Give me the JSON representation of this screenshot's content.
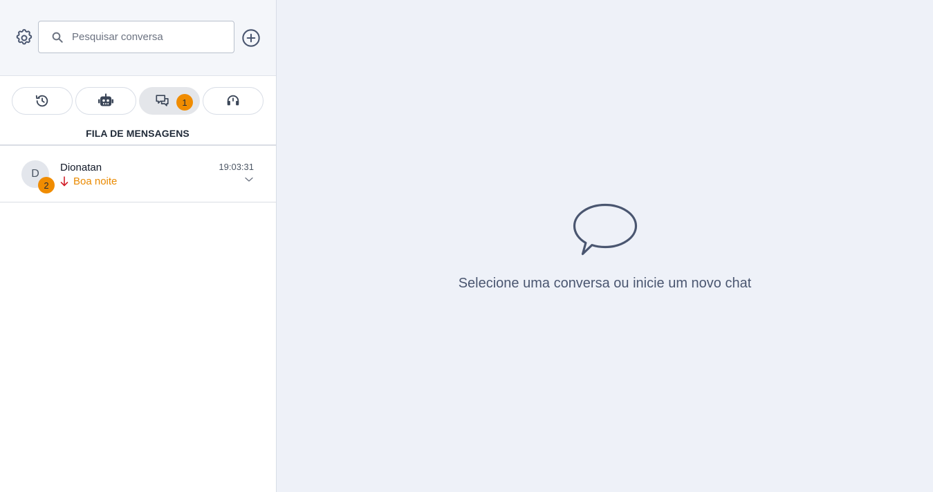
{
  "sidebar": {
    "search": {
      "placeholder": "Pesquisar conversa",
      "value": ""
    },
    "tabs": [
      {
        "name": "history",
        "icon": "history-icon",
        "active": false
      },
      {
        "name": "bot",
        "icon": "robot-icon",
        "active": false
      },
      {
        "name": "queue",
        "icon": "chat-bubbles-icon",
        "active": true,
        "badge": "1"
      },
      {
        "name": "support",
        "icon": "headset-icon",
        "active": false
      }
    ],
    "section_title": "FILA DE MENSAGENS",
    "conversations": [
      {
        "avatar_initial": "D",
        "unread_count": "2",
        "name": "Dionatan",
        "last_message": "Boa noite",
        "time": "19:03:31"
      }
    ]
  },
  "main": {
    "empty_state_text": "Selecione uma conversa ou inicie um novo chat"
  },
  "colors": {
    "accent_orange": "#f08c00",
    "icon_slate": "#4a5670",
    "incoming_arrow_red": "#d21f2a",
    "main_background": "#eef1f8"
  }
}
